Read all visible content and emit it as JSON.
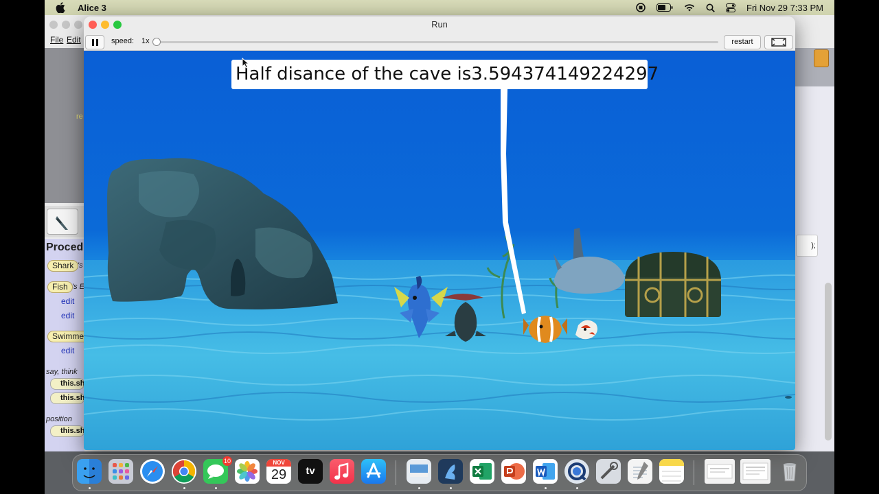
{
  "menubar": {
    "app_name": "Alice 3",
    "datetime": "Fri Nov 29  7:33 PM"
  },
  "ide": {
    "menu_file": "File",
    "menu_edit": "Edit",
    "truncated_label": "re",
    "procedures_title": "Proced",
    "items": [
      {
        "pill": "Shark",
        "suffix": "'s"
      },
      {
        "pill": "Fish",
        "suffix": "'s E"
      },
      {
        "pill": "Swimmer",
        "suffix": ""
      }
    ],
    "edit_label": "edit",
    "category_say_think": "say, think",
    "category_position": "position",
    "tile_label": "this.sh",
    "code_fragment": ");"
  },
  "run_window": {
    "title": "Run",
    "speed_label": "speed:",
    "speed_value": "1x",
    "speed_fraction": 0.0,
    "restart_label": "restart",
    "speech_bubble": "Half disance of the cave is3.594374149224297"
  },
  "dock": {
    "calendar_month": "NOV",
    "calendar_day": "29",
    "tv_label": "tv",
    "messages_badge": "10",
    "apps": [
      "finder-icon",
      "launchpad-icon",
      "safari-icon",
      "chrome-icon",
      "messages-icon",
      "photos-icon",
      "calendar-icon",
      "appletv-icon",
      "music-icon",
      "appstore-icon",
      "preview-icon",
      "alice-icon",
      "excel-icon",
      "powerpoint-icon",
      "word-icon",
      "quicktime-icon",
      "utility-icon",
      "textedit-icon",
      "notes-icon",
      "document-thumb-icon",
      "document-thumb-icon",
      "trash-icon"
    ]
  },
  "colors": {
    "water_top": "#0a56d4",
    "water_bottom": "#2fb0e0",
    "accent_red": "#ff5f57",
    "accent_yellow": "#febc2e",
    "accent_green": "#28c840"
  }
}
